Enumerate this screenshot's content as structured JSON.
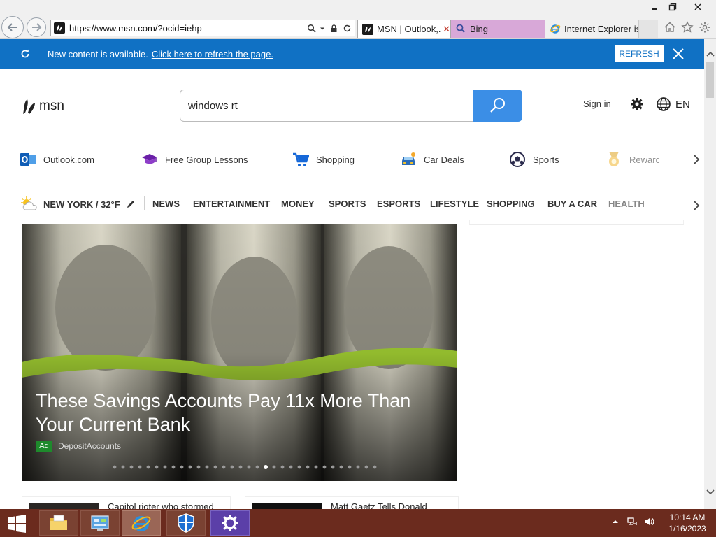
{
  "browser": {
    "url": "https://www.msn.com/?ocid=iehp",
    "tabs": [
      {
        "label": "MSN | Outlook,...",
        "active": true
      },
      {
        "label": "Bing",
        "active": false
      },
      {
        "label": "Internet Explorer is...",
        "active": false
      }
    ],
    "tab_close": "✕"
  },
  "notification": {
    "text": "New content is available.",
    "link": "Click here to refresh the page.",
    "button": "REFRESH"
  },
  "header": {
    "logo": "msn",
    "search_value": "windows rt",
    "sign_in": "Sign in",
    "language": "EN"
  },
  "quick_links": [
    {
      "label": "Outlook.com",
      "icon": "outlook-icon"
    },
    {
      "label": "Free Group Lessons",
      "icon": "graduation-cap-icon"
    },
    {
      "label": "Shopping",
      "icon": "shopping-cart-icon"
    },
    {
      "label": "Car Deals",
      "icon": "car-icon"
    },
    {
      "label": "Sports",
      "icon": "soccer-ball-icon"
    },
    {
      "label": "Rewards",
      "icon": "medal-icon"
    }
  ],
  "weather": {
    "label": "NEW YORK / 32°F"
  },
  "categories": [
    "NEWS",
    "ENTERTAINMENT",
    "MONEY",
    "SPORTS",
    "ESPORTS",
    "LIFESTYLE",
    "SHOPPING",
    "BUY A CAR",
    "HEALTH"
  ],
  "hero": {
    "title": "These Savings Accounts Pay 11x More Than Your Current Bank",
    "badge": "Ad",
    "source": "DepositAccounts",
    "dot_count": 32,
    "active_dot": 18
  },
  "cards": [
    {
      "title": "Capitol rioter who stormed"
    },
    {
      "title": "Matt Gaetz Tells Donald"
    }
  ],
  "taskbar": {
    "time": "10:14 AM",
    "date": "1/16/2023"
  },
  "colors": {
    "notify_bar": "#1071c4",
    "search_button": "#3b8ee6",
    "taskbar": "#6b2b1e",
    "ad_badge": "#1e8a2c"
  }
}
